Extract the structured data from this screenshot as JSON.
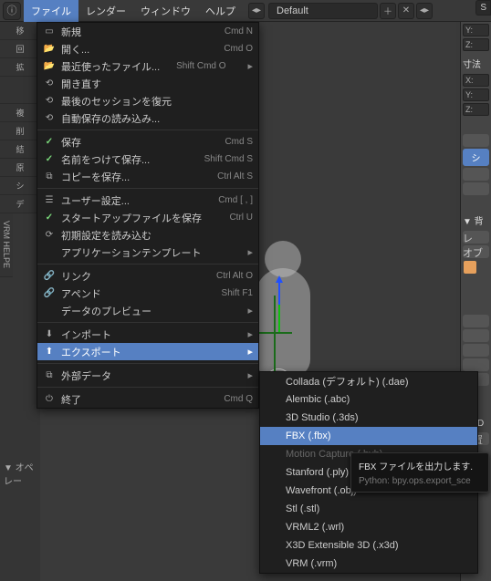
{
  "header": {
    "menu": {
      "file": "ファイル",
      "render": "レンダー",
      "window": "ウィンドウ",
      "help": "ヘルプ"
    },
    "layout_field": "Default",
    "scene_btn": "S"
  },
  "file_menu": {
    "new": {
      "label": "新規",
      "shortcut": "Cmd N"
    },
    "open": {
      "label": "開く...",
      "shortcut": "Cmd O"
    },
    "recent": {
      "label": "最近使ったファイル...",
      "shortcut": "Shift Cmd O"
    },
    "revert": {
      "label": "開き直す"
    },
    "recover_last": {
      "label": "最後のセッションを復元"
    },
    "recover_auto": {
      "label": "自動保存の読み込み..."
    },
    "save": {
      "label": "保存",
      "shortcut": "Cmd S"
    },
    "save_as": {
      "label": "名前をつけて保存...",
      "shortcut": "Shift Cmd S"
    },
    "save_copy": {
      "label": "コピーを保存...",
      "shortcut": "Ctrl Alt S"
    },
    "user_prefs": {
      "label": "ユーザー設定...",
      "shortcut": "Cmd [ , ]"
    },
    "save_startup": {
      "label": "スタートアップファイルを保存",
      "shortcut": "Ctrl U"
    },
    "load_factory": {
      "label": "初期設定を読み込む"
    },
    "app_template": {
      "label": "アプリケーションテンプレート"
    },
    "link": {
      "label": "リンク",
      "shortcut": "Ctrl Alt O"
    },
    "append": {
      "label": "アペンド",
      "shortcut": "Shift F1"
    },
    "data_preview": {
      "label": "データのプレビュー"
    },
    "import": {
      "label": "インポート"
    },
    "export": {
      "label": "エクスポート"
    },
    "external_data": {
      "label": "外部データ"
    },
    "quit": {
      "label": "終了",
      "shortcut": "Cmd Q"
    }
  },
  "export_submenu": {
    "collada": "Collada (デフォルト) (.dae)",
    "alembic": "Alembic (.abc)",
    "studio3d": "3D Studio (.3ds)",
    "fbx": "FBX (.fbx)",
    "bvh": "Motion Capture (.bvh)",
    "stanford": "Stanford (.ply)",
    "wavefront": "Wavefront (.obj)",
    "stl": "Stl (.stl)",
    "vrml2": "VRML2 (.wrl)",
    "x3d": "X3D Extensible 3D (.x3d)",
    "vrm": "VRM (.vrm)"
  },
  "tooltip": {
    "main": "FBX ファイルを出力します.",
    "python": "Python: bpy.ops.export_sce"
  },
  "left_panel": {
    "vrm": "VRM HELPE",
    "operator": "▼ オペレー"
  },
  "right_panel": {
    "y": "Y:",
    "z": "Z:",
    "dimensions": "寸法",
    "x": "X:",
    "shape": "シ",
    "bg": "▼ 背",
    "le": "レ",
    "op": "オブ",
    "d3": "▶ 3D",
    "so": "設置"
  }
}
